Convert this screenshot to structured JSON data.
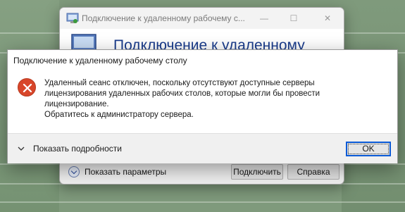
{
  "rdp_window": {
    "title": "Подключение к удаленному рабочему с...",
    "heading": "Подключение к удаленному",
    "show_params_label": "Показать параметры",
    "connect_label": "Подключить",
    "help_label": "Справка",
    "controls": {
      "minimize": "—",
      "maximize": "☐",
      "close": "✕"
    },
    "icons": {
      "app": "remote-desktop-icon",
      "monitor": "monitor-icon",
      "expander": "chevron-down-circle-icon"
    }
  },
  "dialog": {
    "title": "Подключение к удаленному рабочему столу",
    "message_lines": [
      "Удаленный сеанс отключен, поскольку отсутствуют доступные серверы",
      "лицензирования удаленных рабочих столов, которые могли бы провести",
      "лицензирование.",
      "Обратитесь к администратору сервера."
    ],
    "details_label": "Показать подробности",
    "ok_label": "OK",
    "icons": {
      "error": "error-icon",
      "chevron": "chevron-down-icon"
    },
    "error_color": "#d8462a",
    "focus_color": "#0a5ad6"
  },
  "colors": {
    "heading_blue": "#1a3c8c",
    "desktop_green": "#7f9a7c"
  }
}
